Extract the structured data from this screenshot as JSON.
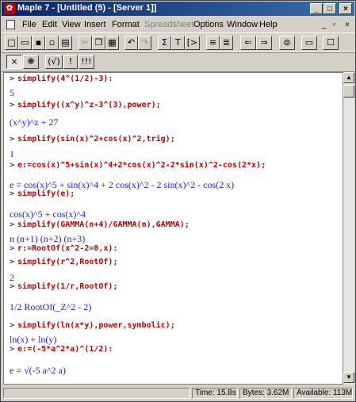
{
  "window": {
    "title": "Maple 7 - [Untitled (5) - [Server 1]]",
    "app_icon": "maple-leaf-icon",
    "minimize": "_",
    "maximize": "□",
    "close": "×"
  },
  "menu": [
    "File",
    "Edit",
    "View",
    "Insert",
    "Format",
    "Spreadsheet",
    "Options",
    "Window",
    "Help"
  ],
  "menu_disabled_index": 5,
  "mdi_controls": {
    "minimize": "_",
    "restore": "▫",
    "close": "×"
  },
  "toolbar1": [
    "new-icon",
    "open-icon",
    "save-icon",
    "save-all-icon",
    "print-icon",
    "cut-icon",
    "copy-icon",
    "paste-icon",
    "undo-icon",
    "redo-icon",
    "sigma-icon",
    "T-icon",
    "prompt-icon",
    "indent-icon",
    "outdent-icon",
    "back-icon",
    "forward-icon",
    "stop-icon",
    "restart-icon"
  ],
  "toolbar2": {
    "labels": [
      "×",
      "❋",
      "(√)",
      "!",
      "!!!"
    ],
    "icons": [
      "stop-execution-icon",
      "debug-icon",
      "sqrt-icon",
      "execute-icon",
      "execute-all-icon"
    ]
  },
  "worksheet": {
    "prompt": ">",
    "lines": [
      {
        "kind": "input",
        "text": "simplify(4^(1/2)-3):"
      },
      {
        "kind": "output",
        "text": "5"
      },
      {
        "kind": "input",
        "text": "simplify((x^y)^z-3^(3),power);"
      },
      {
        "kind": "output",
        "text": "(x^y)^z + 27"
      },
      {
        "kind": "input",
        "text": "simplify(sin(x)^2+cos(x)^2,trig);"
      },
      {
        "kind": "output",
        "text": "1"
      },
      {
        "kind": "input",
        "text": "e:=cos(x)^5+sin(x)^4+2*cos(x)^2-2*sin(x)^2-cos(2*x);"
      },
      {
        "kind": "output",
        "text": "e = cos(x)^5 + sin(x)^4 + 2 cos(x)^2 - 2 sin(x)^2 - cos(2 x)"
      },
      {
        "kind": "input",
        "text": "simplify(e);"
      },
      {
        "kind": "output",
        "text": "cos(x)^5 + cos(x)^4"
      },
      {
        "kind": "input",
        "text": "simplify(GAMMA(n+4)/GAMMA(n),GAMMA);"
      },
      {
        "kind": "output",
        "text": "n (n+1) (n+2) (n+3)"
      },
      {
        "kind": "input",
        "text": "r:=RootOf(x^2-2=0,x):"
      },
      {
        "kind": "input",
        "text": "simplify(r^2,RootOf);"
      },
      {
        "kind": "output",
        "text": "2"
      },
      {
        "kind": "input",
        "text": "simplify(1/r,RootOf);"
      },
      {
        "kind": "output",
        "text": "1/2 RootOf(_Z^2 - 2)"
      },
      {
        "kind": "input",
        "text": "simplify(ln(x*y),power,symbolic);"
      },
      {
        "kind": "output",
        "text": "ln(x) + ln(y)"
      },
      {
        "kind": "input",
        "text": "e:=(-5*a^2*a)^(1/2):"
      },
      {
        "kind": "output",
        "text": "e = √(-5 a^2 a)"
      }
    ]
  },
  "status": {
    "time": "Time: 15.8s",
    "bytes": "Bytes: 3.62M",
    "available": "Available: 113M"
  }
}
